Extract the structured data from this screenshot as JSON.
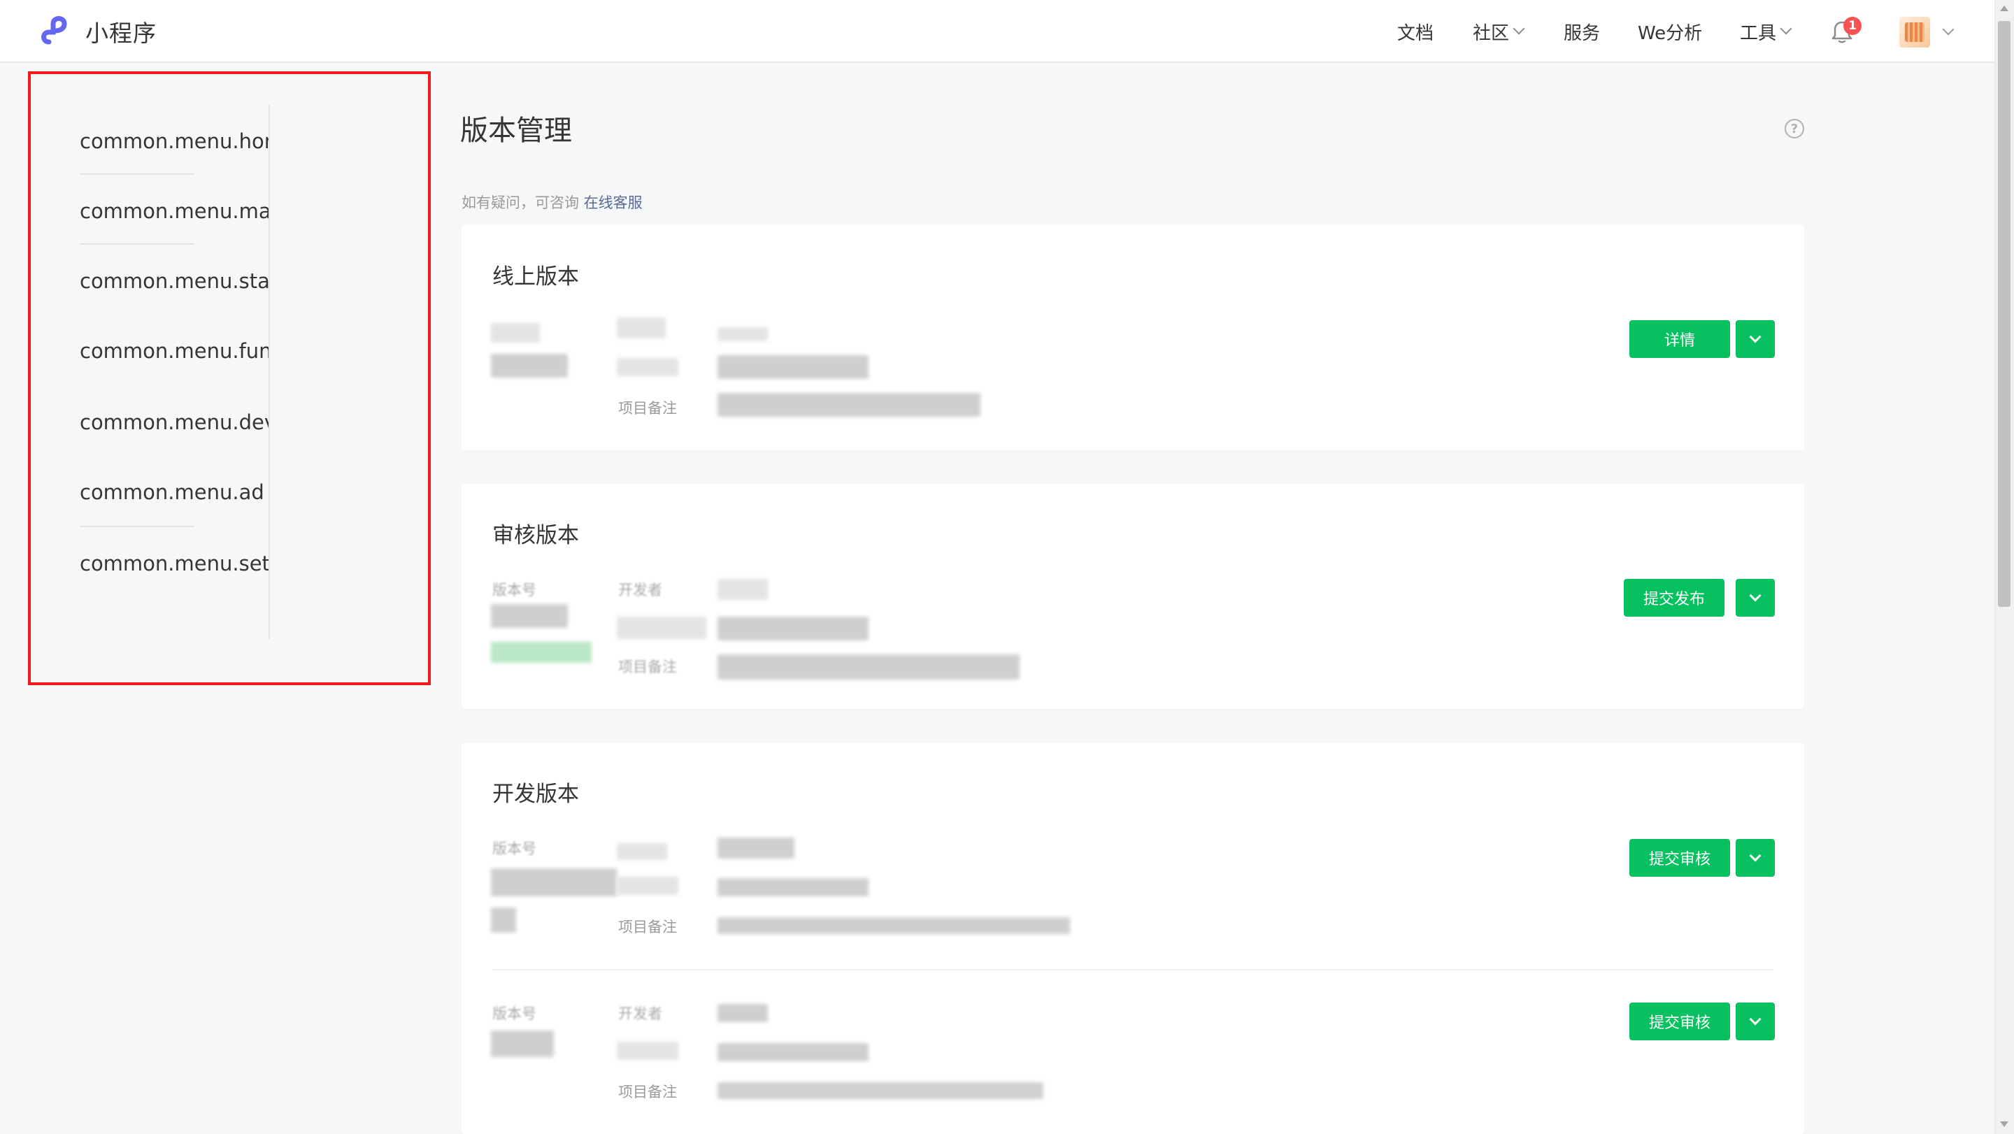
{
  "header": {
    "app_name": "小程序",
    "nav": {
      "docs": "文档",
      "community": "社区",
      "services": "服务",
      "analytics": "We分析",
      "tools": "工具"
    },
    "notification_count": "1"
  },
  "sidebar": {
    "items": [
      {
        "label": "common.menu.home"
      },
      {
        "label": "common.menu.manage"
      },
      {
        "label": "common.menu.stat"
      },
      {
        "label": "common.menu.func"
      },
      {
        "label": "common.menu.devel"
      },
      {
        "label": "common.menu.ad"
      },
      {
        "label": "common.menu.settin"
      }
    ]
  },
  "main": {
    "title": "版本管理",
    "help": "?",
    "tip_text": "如有疑问，可咨询 ",
    "tip_link": "在线客服",
    "online": {
      "title": "线上版本",
      "remark_label": "项目备注",
      "detail_button": "详情"
    },
    "review": {
      "title": "审核版本",
      "version_label": "版本号",
      "developer_label": "开发者",
      "remark_label": "项目备注",
      "publish_button": "提交发布"
    },
    "dev": {
      "title": "开发版本",
      "rows": [
        {
          "version_label": "版本号",
          "remark_label": "项目备注",
          "submit_button": "提交审核"
        },
        {
          "version_label": "版本号",
          "developer_label": "开发者",
          "remark_label": "项目备注",
          "submit_button": "提交审核"
        }
      ]
    }
  },
  "colors": {
    "accent_green": "#07c160",
    "highlight_red": "#f51a1a",
    "link_blue": "#576b95",
    "brand_purple": "#6467f0"
  }
}
